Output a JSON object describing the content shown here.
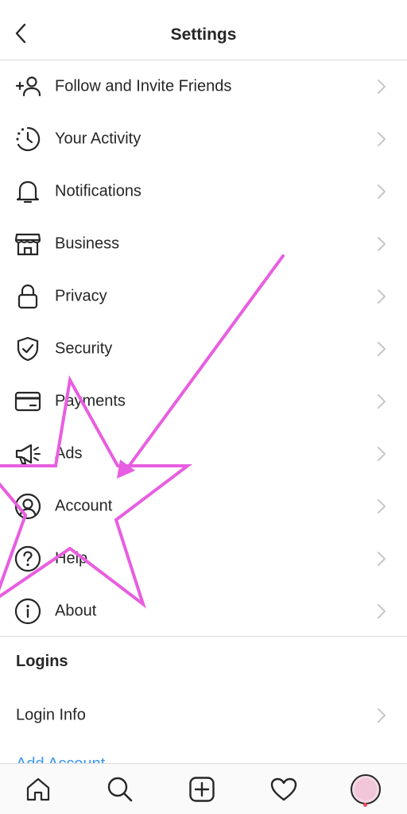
{
  "header": {
    "title": "Settings",
    "back_icon": "chevron-left-icon"
  },
  "menu": {
    "items": [
      {
        "label": "Follow and Invite Friends",
        "icon": "add-person-icon"
      },
      {
        "label": "Your Activity",
        "icon": "activity-clock-icon"
      },
      {
        "label": "Notifications",
        "icon": "bell-icon"
      },
      {
        "label": "Business",
        "icon": "storefront-icon"
      },
      {
        "label": "Privacy",
        "icon": "lock-icon"
      },
      {
        "label": "Security",
        "icon": "shield-check-icon"
      },
      {
        "label": "Payments",
        "icon": "credit-card-icon"
      },
      {
        "label": "Ads",
        "icon": "megaphone-icon"
      },
      {
        "label": "Account",
        "icon": "user-circle-icon"
      },
      {
        "label": "Help",
        "icon": "help-circle-icon"
      },
      {
        "label": "About",
        "icon": "info-circle-icon"
      }
    ]
  },
  "logins": {
    "heading": "Logins",
    "login_info_label": "Login Info",
    "add_account_label": "Add Account"
  },
  "tabbar": {
    "tabs": [
      "home-icon",
      "search-icon",
      "new-post-icon",
      "heart-icon",
      "profile-avatar"
    ]
  },
  "colors": {
    "text": "#262626",
    "divider": "#dbdbdb",
    "chevron": "#c7c7c7",
    "link": "#3897f0",
    "annotation": "#e85ee0"
  }
}
